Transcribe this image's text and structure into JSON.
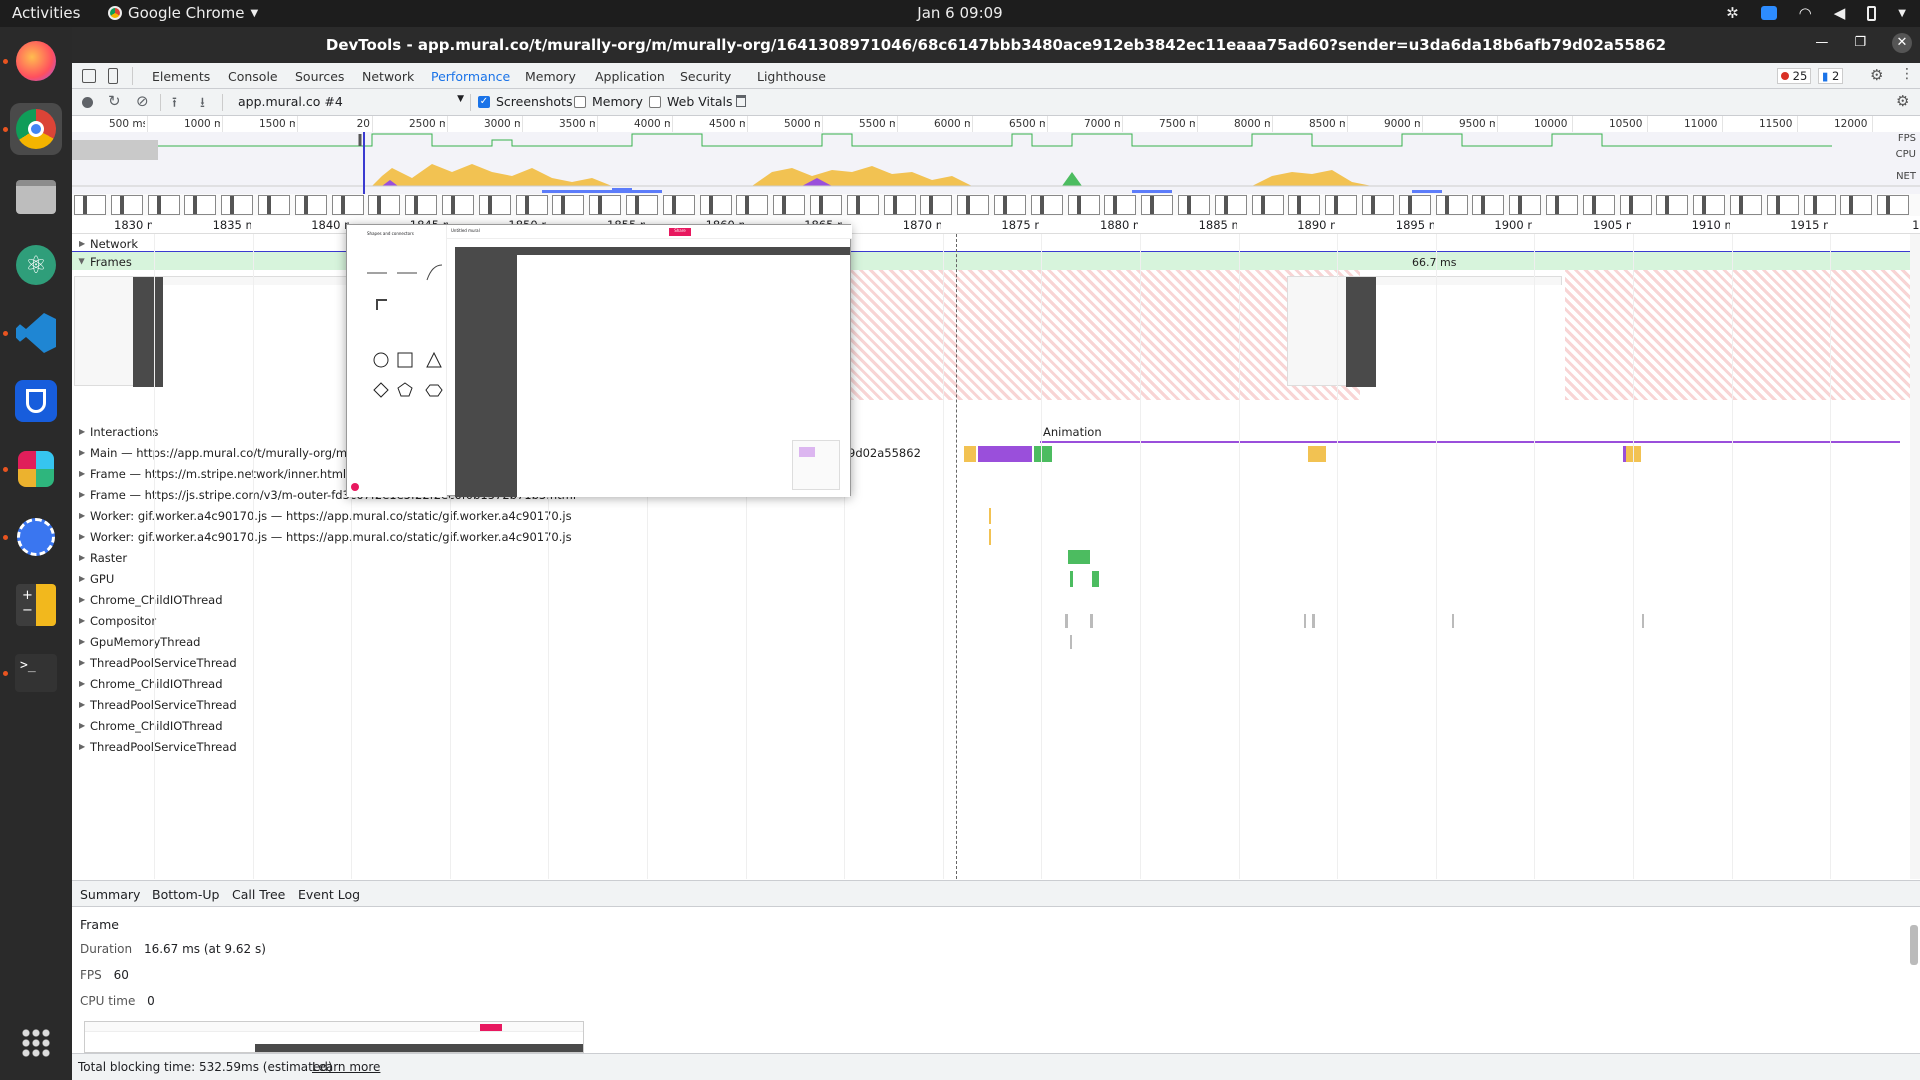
{
  "system": {
    "activities": "Activities",
    "app_name": "Google Chrome",
    "clock": "Jan 6  09:09"
  },
  "window": {
    "title": "DevTools - app.mural.co/t/murally-org/m/murally-org/1641308971046/68c6147bbb3480ace912eb3842ec11eaaa75ad60?sender=u3da6da18b6afb79d02a55862"
  },
  "devtools": {
    "tabs": [
      "Elements",
      "Console",
      "Sources",
      "Network",
      "Performance",
      "Memory",
      "Application",
      "Security",
      "Lighthouse"
    ],
    "active_tab": "Performance",
    "errors_count": "25",
    "messages_count": "2"
  },
  "perf_toolbar": {
    "profile_select": "app.mural.co #4",
    "screenshots_label": "Screenshots",
    "screenshots_checked": true,
    "memory_label": "Memory",
    "memory_checked": false,
    "web_vitals_label": "Web Vitals",
    "web_vitals_checked": false
  },
  "overview": {
    "ticks": [
      "500 ms",
      "1000 ms",
      "1500 ms",
      "20",
      "2500 ms",
      "3000 ms",
      "3500 ms",
      "4000 ms",
      "4500 ms",
      "5000 ms",
      "5500 ms",
      "6000 ms",
      "6500 ms",
      "7000 ms",
      "7500 ms",
      "8000 ms",
      "8500 ms",
      "9000 ms",
      "9500 ms",
      "10000 ms",
      "10500 ms",
      "11000 ms",
      "11500 ms",
      "12000 ms"
    ],
    "lane_labels": {
      "fps": "FPS",
      "cpu": "CPU",
      "net": "NET"
    }
  },
  "ruler": {
    "ticks": [
      "1830 ms",
      "1835 ms",
      "1840 ms",
      "1845 ms",
      "1850 ms",
      "1855 ms",
      "1860 ms",
      "1865 ms",
      "1870 ms",
      "1875 ms",
      "1880 ms",
      "1885 ms",
      "1890 ms",
      "1895 ms",
      "1900 ms",
      "1905 ms",
      "1910 ms",
      "1915 ms",
      "19"
    ]
  },
  "tracks": {
    "network": "Network",
    "frames": "Frames",
    "frame_duration": "66.7 ms",
    "interactions": "Interactions",
    "animation": "Animation",
    "main": "Main — https://app.mural.co/t/murally-org/m/mura",
    "main_suffix": "9d02a55862",
    "frame_stripe": "Frame — https://m.stripe.network/inner.html",
    "frame_js_stripe": "Frame — https://js.stripe.com/v3/m-outer-fd3c67f2e1e5f22f2ec6f0b1572b71b3.html",
    "worker1": "Worker: gif.worker.a4c90170.js — https://app.mural.co/static/gif.worker.a4c90170.js",
    "worker2": "Worker: gif.worker.a4c90170.js — https://app.mural.co/static/gif.worker.a4c90170.js",
    "raster": "Raster",
    "gpu": "GPU",
    "chrome_io_1": "Chrome_ChildIOThread",
    "compositor": "Compositor",
    "gpu_memory": "GpuMemoryThread",
    "threadpool_1": "ThreadPoolServiceThread",
    "chrome_io_2": "Chrome_ChildIOThread",
    "threadpool_2": "ThreadPoolServiceThread",
    "chrome_io_3": "Chrome_ChildIOThread",
    "threadpool_3": "ThreadPoolServiceThread"
  },
  "popup": {
    "panel_title": "Shapes and connectors",
    "board_title": "Untitled mural",
    "share_label": "Share"
  },
  "bottom_tabs": [
    "Summary",
    "Bottom-Up",
    "Call Tree",
    "Event Log"
  ],
  "summary": {
    "heading": "Frame",
    "duration_label": "Duration",
    "duration_value": "16.67 ms (at 9.62 s)",
    "fps_label": "FPS",
    "fps_value": "60",
    "cpu_label": "CPU time",
    "cpu_value": "0"
  },
  "status": {
    "text": "Total blocking time: 532.59ms (estimated)",
    "link": "Learn more"
  },
  "colors": {
    "accent": "#1a73e8",
    "scripting": "#f2c252",
    "rendering": "#9a4fdb",
    "painting": "#4cbc60",
    "fps": "#8ee09b",
    "dropped_frame": "#f4c4c4"
  }
}
